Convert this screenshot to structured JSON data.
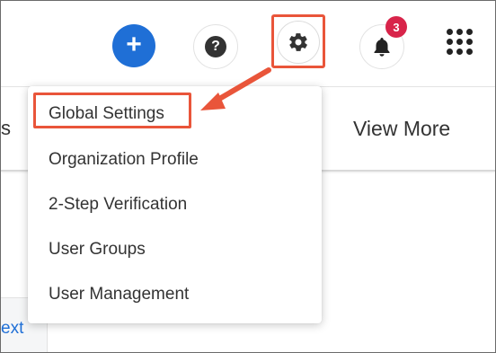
{
  "header": {
    "add_icon": "plus-icon",
    "help_icon": "question-icon",
    "help_glyph": "?",
    "settings_icon": "gear-icon",
    "notifications_icon": "bell-icon",
    "notification_count": "3",
    "apps_icon": "grid-icon"
  },
  "tabs": {
    "partial_label": "s",
    "view_more_label": "View More"
  },
  "settings_menu": {
    "items": [
      {
        "label": "Global Settings",
        "highlighted": true
      },
      {
        "label": "Organization Profile"
      },
      {
        "label": "2-Step Verification"
      },
      {
        "label": "User Groups"
      },
      {
        "label": "User Management"
      }
    ]
  },
  "content": {
    "next_link_partial": "ext"
  },
  "colors": {
    "accent_blue": "#1f6fd6",
    "annotation_red": "#e9553a",
    "badge_red": "#d8244a"
  }
}
